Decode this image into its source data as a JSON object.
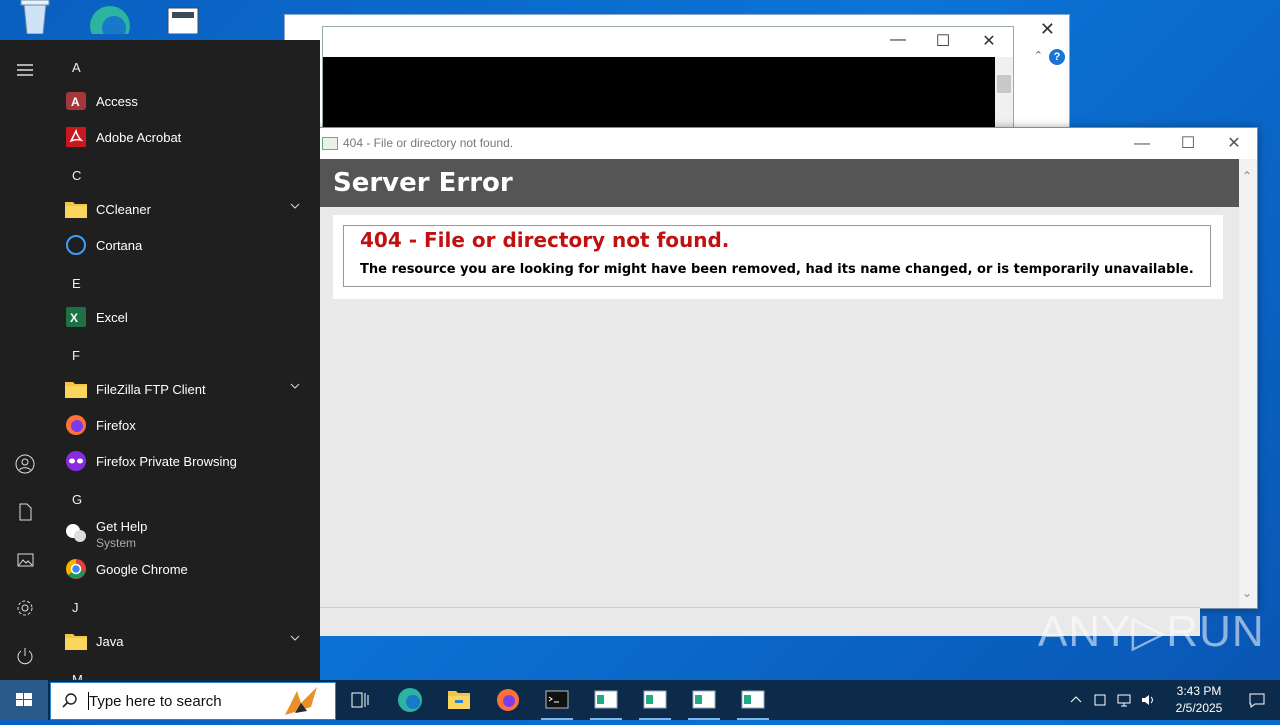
{
  "desktop": {
    "icons": [
      "recycle-bin-icon",
      "edge-icon",
      "document-icon"
    ]
  },
  "cmd_window": {
    "title": "",
    "controls": {
      "minimize": "—",
      "maximize": "☐",
      "close": "✕"
    }
  },
  "ie_window": {
    "title": "404 - File or directory not found.",
    "server_error": "Server Error",
    "error_title": "404 - File or directory not found.",
    "error_desc": "The resource you are looking for might have been removed, had its name changed, or is temporarily unavailable.",
    "controls": {
      "minimize": "—",
      "maximize": "☐",
      "close": "✕"
    }
  },
  "start_menu": {
    "sections": [
      {
        "letter": "A",
        "apps": [
          {
            "label": "Access",
            "icon": "access-icon"
          },
          {
            "label": "Adobe Acrobat",
            "icon": "acrobat-icon"
          }
        ]
      },
      {
        "letter": "C",
        "apps": [
          {
            "label": "CCleaner",
            "icon": "folder-icon",
            "expandable": true
          },
          {
            "label": "Cortana",
            "icon": "cortana-icon"
          }
        ]
      },
      {
        "letter": "E",
        "apps": [
          {
            "label": "Excel",
            "icon": "excel-icon"
          }
        ]
      },
      {
        "letter": "F",
        "apps": [
          {
            "label": "FileZilla FTP Client",
            "icon": "folder-icon",
            "expandable": true
          },
          {
            "label": "Firefox",
            "icon": "firefox-icon"
          },
          {
            "label": "Firefox Private Browsing",
            "icon": "firefox-private-icon"
          }
        ]
      },
      {
        "letter": "G",
        "apps": [
          {
            "label": "Get Help",
            "sub": "System",
            "icon": "get-help-icon"
          },
          {
            "label": "Google Chrome",
            "icon": "chrome-icon"
          }
        ]
      },
      {
        "letter": "J",
        "apps": [
          {
            "label": "Java",
            "icon": "folder-icon",
            "expandable": true
          }
        ]
      },
      {
        "letter": "M",
        "apps": []
      }
    ],
    "rail": [
      "hamburger-icon",
      "user-icon",
      "documents-icon",
      "pictures-icon",
      "settings-icon",
      "power-icon"
    ]
  },
  "taskbar": {
    "search_placeholder": "Type here to search",
    "clock_time": "3:43 PM",
    "clock_date": "2/5/2025",
    "apps": [
      "task-view-icon",
      "edge-icon",
      "file-explorer-icon",
      "firefox-icon",
      "cmd-icon",
      "ie-window-icon",
      "ie-window-icon",
      "ie-window-icon",
      "ie-window-icon"
    ]
  },
  "watermark": "ANY▷RUN",
  "colors": {
    "error_red": "#c01010",
    "server_bar": "#555555",
    "start_bg": "#1f1f1f",
    "taskbar": "#0c2b4a"
  }
}
